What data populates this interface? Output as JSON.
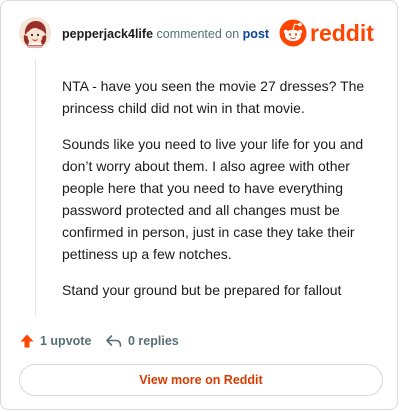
{
  "comment": {
    "author": "pepperjack4life",
    "action_text": "commented on",
    "target_link": "post",
    "paragraphs": [
      "NTA - have you seen the movie 27 dresses? The princess child did not win in that movie.",
      "Sounds like you need to live your life for you and don’t worry about them. I also agree with other people here that you need to have everything password protected and all changes must be confirmed in person, just in case they take their pettiness up a few notches.",
      "Stand your ground but be prepared for fallout"
    ]
  },
  "brand": {
    "name": "reddit",
    "color": "#ff4500"
  },
  "actions": {
    "upvotes": "1 upvote",
    "replies": "0 replies"
  },
  "footer": {
    "view_more": "View more on Reddit"
  },
  "icons": {
    "upvote": "upvote-arrow-icon",
    "reply": "reply-arrow-icon",
    "logo": "reddit-snoo-logo"
  }
}
